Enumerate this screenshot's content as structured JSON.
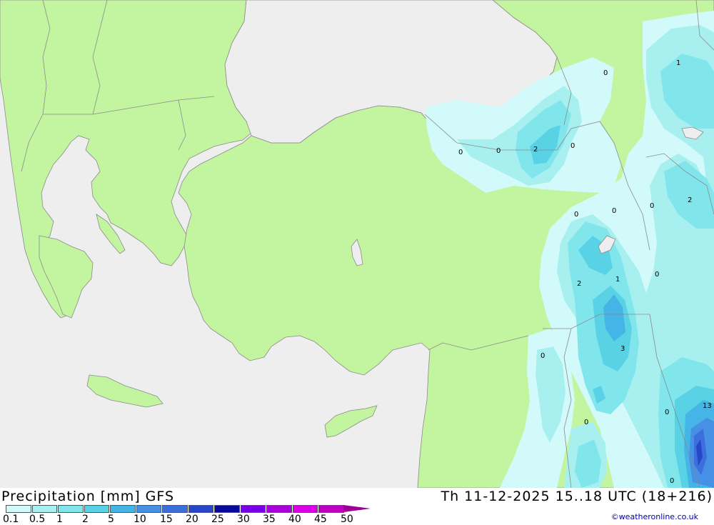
{
  "title": "Precipitation [mm] GFS",
  "datetime": "Th 11-12-2025 15..18 UTC (18+216)",
  "credit": "©weatheronline.co.uk",
  "legend": {
    "labels": [
      "0.1",
      "0.5",
      "1",
      "2",
      "5",
      "10",
      "15",
      "20",
      "25",
      "30",
      "35",
      "40",
      "45",
      "50"
    ],
    "colors": [
      "#d2fafa",
      "#a8f0f0",
      "#80e6ec",
      "#5ad2e6",
      "#45b4e6",
      "#4690e6",
      "#3c6edc",
      "#2846c8",
      "#0a0a9a",
      "#7800e6",
      "#aa00dc",
      "#dc00e6",
      "#c000c0",
      "#9c0096"
    ]
  },
  "colors": {
    "land": "#c3f5a0",
    "sea": "#eeeeee",
    "border": "#8a8a8a"
  },
  "map_values": [
    "0",
    "0",
    "2",
    "0",
    "0",
    "1",
    "0",
    "0",
    "0",
    "2",
    "2",
    "1",
    "0",
    "0",
    "3",
    "0",
    "0",
    "0",
    "13",
    "0"
  ]
}
